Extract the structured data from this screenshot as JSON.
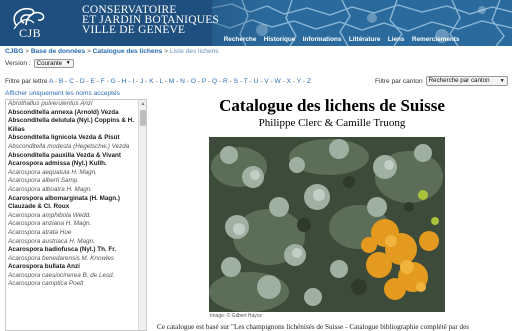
{
  "header": {
    "logo_text": "CJB",
    "org_name_lines": [
      "CONSERVATOIRE",
      "ET JARDIN BOTANIQUES",
      "VILLE DE GENÈVE"
    ],
    "nav": [
      "Recherche",
      "Historique",
      "Informations",
      "Littérature",
      "Liens",
      "Remerciements"
    ]
  },
  "breadcrumb": {
    "items": [
      "CJBG",
      "Base de données",
      "Catalogue des lichens"
    ],
    "current": "Liste des lichens",
    "separator": ">"
  },
  "version": {
    "label": "Version :",
    "selected": "Courante"
  },
  "letter_filter": {
    "label": "Filtre par lettre",
    "letters": [
      "A",
      "B",
      "C",
      "D",
      "E",
      "F",
      "G",
      "H",
      "I",
      "J",
      "K",
      "L",
      "M",
      "N",
      "O",
      "P",
      "Q",
      "R",
      "S",
      "T",
      "U",
      "V",
      "W",
      "X",
      "Y",
      "Z"
    ]
  },
  "canton_filter": {
    "label": "Filtre par canton",
    "selected": "Recherche par canton"
  },
  "show_accepted_link": "Afficher uniquement les noms acceptés",
  "species": [
    {
      "name": "Abrothallus pulverulentus Anzi",
      "accepted": false
    },
    {
      "name": "Absconditella annexa (Arnold) Vezda",
      "accepted": true
    },
    {
      "name": "Absconditella delutula (Nyl.) Coppins & H. Kilias",
      "accepted": true
    },
    {
      "name": "Absconditella lignicola Vezda & Pisút",
      "accepted": true
    },
    {
      "name": "Absconditella modesta (Hegetschw.) Vezda",
      "accepted": false
    },
    {
      "name": "Absconditella pauxilla Vezda & Vivant",
      "accepted": true
    },
    {
      "name": "Acarospora admissa (Nyl.) Kullh.",
      "accepted": true
    },
    {
      "name": "Acarospora aequatula H. Magn.",
      "accepted": false
    },
    {
      "name": "Acarospora alberti Samp.",
      "accepted": false
    },
    {
      "name": "Acarospora alboatra H. Magn.",
      "accepted": false
    },
    {
      "name": "Acarospora albomarginata (H. Magn.) Clauzade & Cl. Roux",
      "accepted": true
    },
    {
      "name": "Acarospora amphibola Wedd.",
      "accepted": false
    },
    {
      "name": "Acarospora anziana H. Magn.",
      "accepted": false
    },
    {
      "name": "Acarospora atrata Hue",
      "accepted": false
    },
    {
      "name": "Acarospora austriaca H. Magn.",
      "accepted": false
    },
    {
      "name": "Acarospora badiofusca (Nyl.) Th. Fr.",
      "accepted": true
    },
    {
      "name": "Acarospora benedarensis M. Knowles",
      "accepted": false
    },
    {
      "name": "Acarospora bullata Anzi",
      "accepted": true
    },
    {
      "name": "Acarospora caesiocinerea B. de Lesd.",
      "accepted": false
    },
    {
      "name": "Acarospora camptica Poelt",
      "accepted": false
    }
  ],
  "main": {
    "title": "Catalogue des lichens de Suisse",
    "authors": "Philippe Clerc & Camille Truong",
    "photo_credit": "Image: © Gilbert Hayoz",
    "intro": "Ce catalogue est basé sur \"Les champignons lichénisés de Suisse - Catalogue bibliographie complété par des"
  },
  "colors": {
    "banner": "#1f4f7e",
    "link": "#2a6cb0",
    "accent_orange": "#e39a1e"
  }
}
